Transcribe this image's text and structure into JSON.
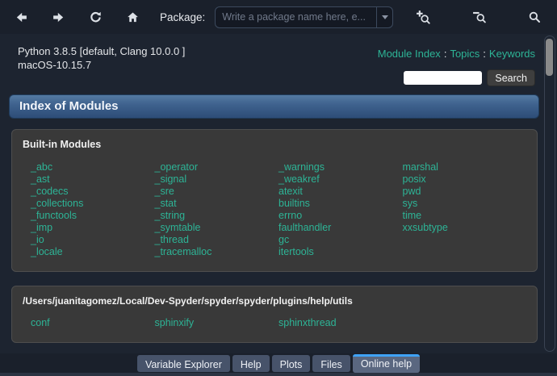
{
  "toolbar": {
    "package_label": "Package:",
    "combo": {
      "placeholder": "Write a package name here, e...",
      "value": ""
    }
  },
  "header": {
    "python_version": "Python 3.8.5 [default, Clang 10.0.0 ]",
    "os_version": "macOS-10.15.7",
    "nav_links": [
      "Module Index",
      "Topics",
      "Keywords"
    ],
    "nav_separator": ":",
    "search": {
      "value": "",
      "button_label": "Search"
    }
  },
  "page_title": "Index of Modules",
  "modules": {
    "builtin": {
      "heading": "Built-in Modules",
      "col1": [
        "_abc",
        "_ast",
        "_codecs",
        "_collections",
        "_functools",
        "_imp",
        "_io",
        "_locale"
      ],
      "col2": [
        "_operator",
        "_signal",
        "_sre",
        "_stat",
        "_string",
        "_symtable",
        "_thread",
        "_tracemalloc"
      ],
      "col3": [
        "_warnings",
        "_weakref",
        "atexit",
        "builtins",
        "errno",
        "faulthandler",
        "gc",
        "itertools"
      ],
      "col4": [
        "marshal",
        "posix",
        "pwd",
        "sys",
        "time",
        "xxsubtype"
      ]
    },
    "utils": {
      "heading": "/Users/juanitagomez/Local/Dev-Spyder/spyder/spyder/plugins/help/utils",
      "col1": [
        "conf"
      ],
      "col2": [
        "sphinxify"
      ],
      "col3": [
        "sphinxthread"
      ],
      "col4": []
    }
  },
  "tabs": {
    "items": [
      {
        "label": "Variable Explorer",
        "active": false
      },
      {
        "label": "Help",
        "active": false
      },
      {
        "label": "Plots",
        "active": false
      },
      {
        "label": "Files",
        "active": false
      },
      {
        "label": "Online help",
        "active": true
      }
    ]
  },
  "colors": {
    "link_teal": "#2db496",
    "active_tab_blue": "#3fa3f8",
    "header_bar_top": "#547aa2",
    "header_bar_bottom": "#2e4d78",
    "panel_bg": "#393939",
    "page_bg": "#1d2430",
    "toolbar_bg": "#1a202b"
  }
}
